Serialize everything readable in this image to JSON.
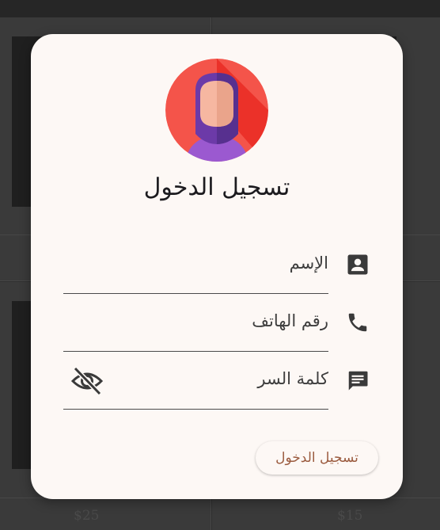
{
  "background": {
    "prices": [
      "$25",
      "$15"
    ]
  },
  "dialog": {
    "avatar_icon": "hijab-woman-avatar-icon",
    "title": "تسجيل الدخول",
    "fields": {
      "name": {
        "label": "الإسم",
        "icon": "contact-card-icon"
      },
      "phone": {
        "label": "رقم الهاتف",
        "icon": "phone-icon"
      },
      "password": {
        "label": "كلمة السر",
        "icon": "message-icon",
        "toggle_icon": "eye-off-icon"
      }
    },
    "login_button": "تسجيل الدخول"
  },
  "colors": {
    "surface": "#fdf8f5",
    "accent": "#9b5b3f",
    "avatar_bg": "#f4544a"
  }
}
